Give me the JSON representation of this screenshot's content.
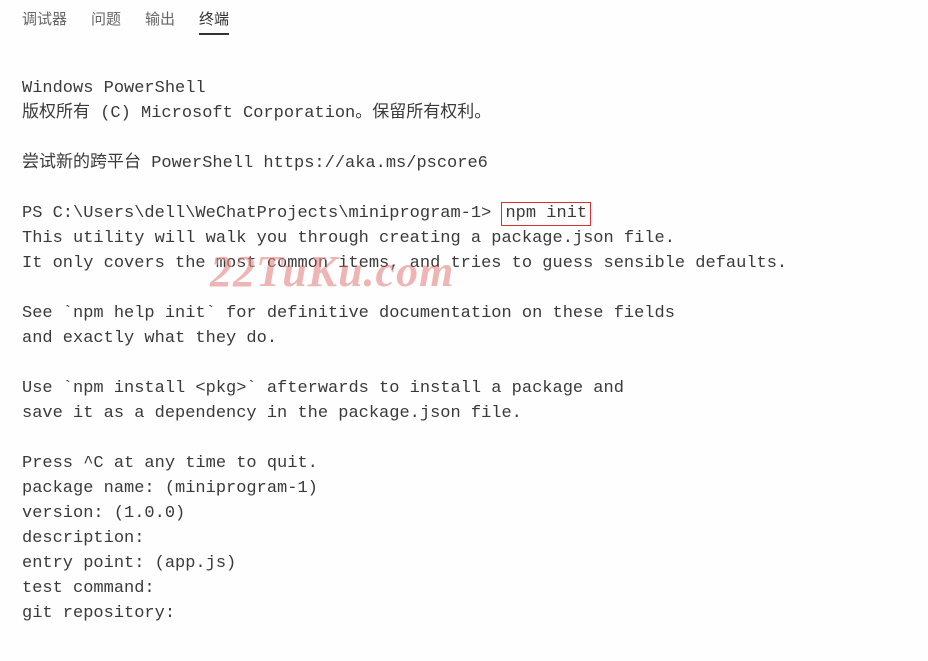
{
  "tabs": {
    "debugger": "调试器",
    "problems": "问题",
    "output": "输出",
    "terminal": "终端"
  },
  "terminal": {
    "line1": "Windows PowerShell",
    "line2": "版权所有 (C) Microsoft Corporation。保留所有权利。",
    "line3": "尝试新的跨平台 PowerShell https://aka.ms/pscore6",
    "prompt": "PS C:\\Users\\dell\\WeChatProjects\\miniprogram-1> ",
    "command": "npm init",
    "line5": "This utility will walk you through creating a package.json file.",
    "line6": "It only covers the most common items, and tries to guess sensible defaults.",
    "line7": "See `npm help init` for definitive documentation on these fields",
    "line8": "and exactly what they do.",
    "line9": "Use `npm install <pkg>` afterwards to install a package and",
    "line10": "save it as a dependency in the package.json file.",
    "line11": "Press ^C at any time to quit.",
    "line12": "package name: (miniprogram-1)",
    "line13": "version: (1.0.0)",
    "line14": "description:",
    "line15": "entry point: (app.js)",
    "line16": "test command:",
    "line17": "git repository:"
  },
  "watermark": "22TuKu.com"
}
